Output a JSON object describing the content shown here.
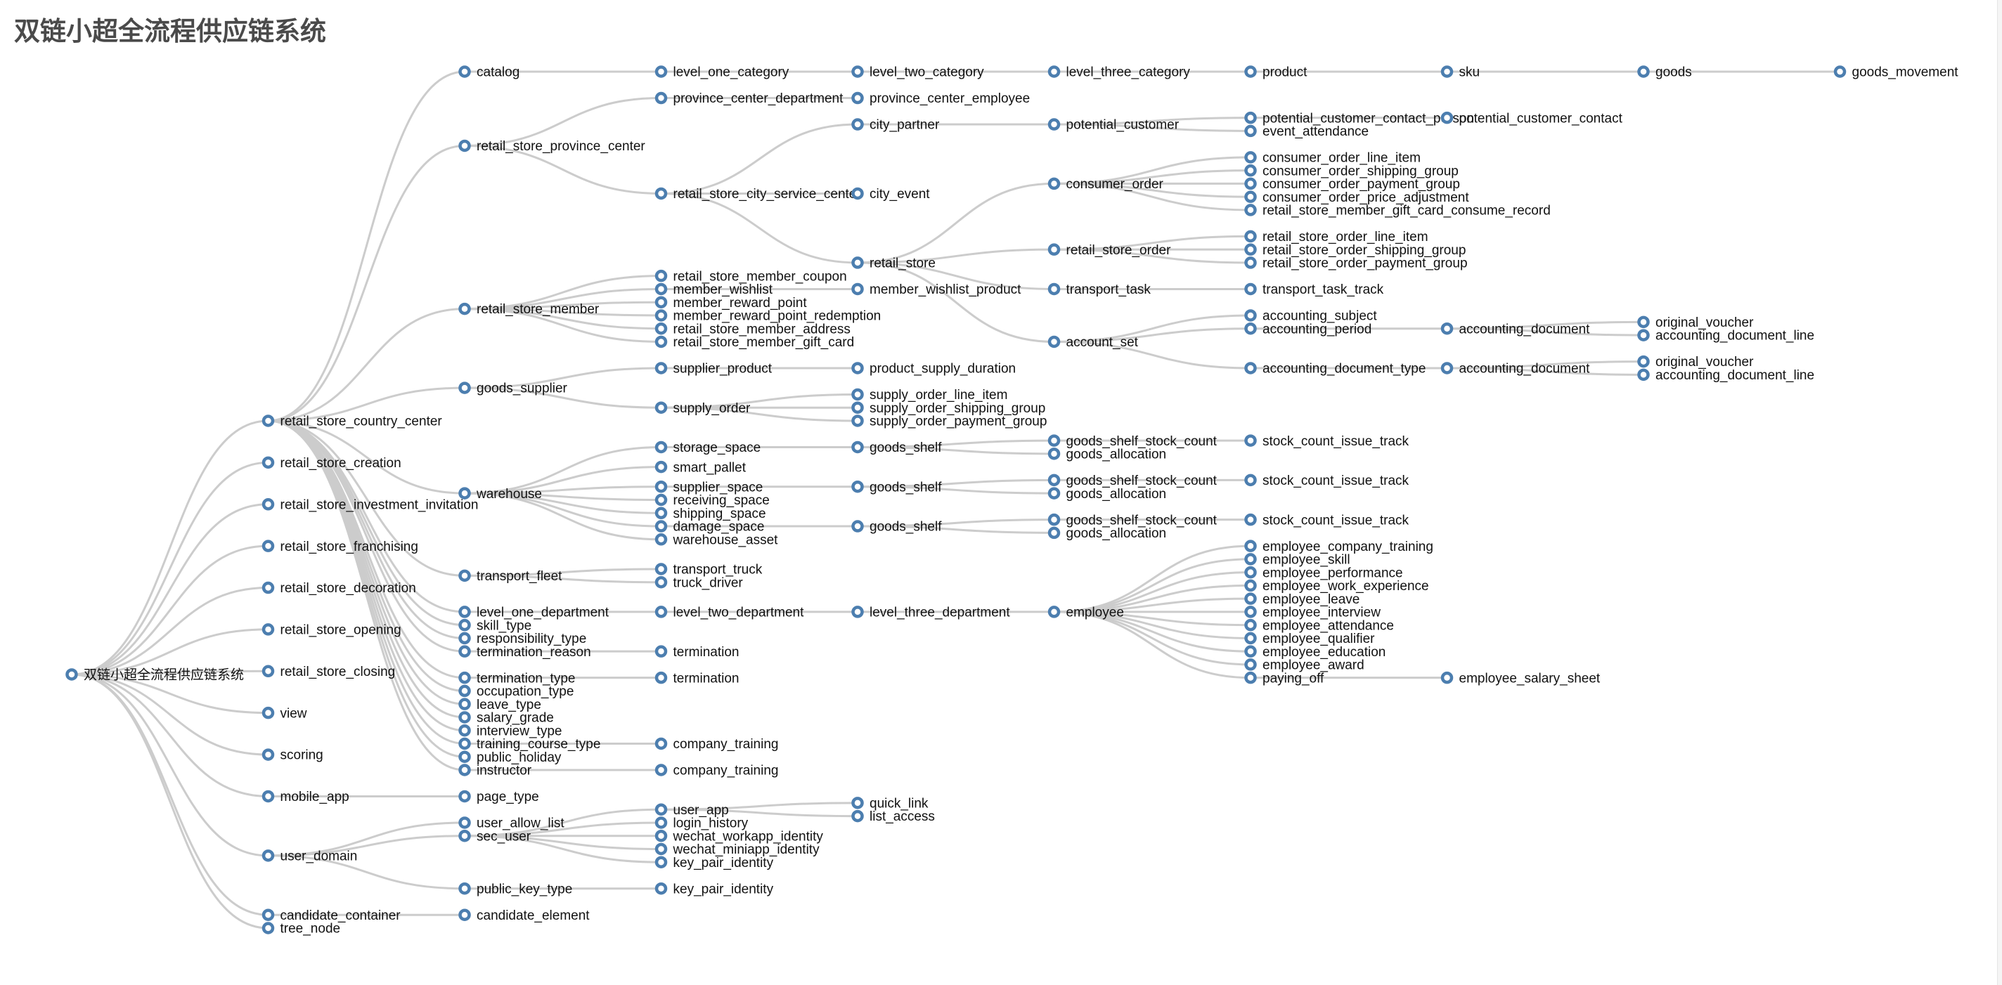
{
  "page": {
    "title": "双链小超全流程供应链系统"
  },
  "colors": {
    "node_stroke": "#4c7eaf",
    "node_fill": "#ffffff",
    "link": "#cccccc",
    "title": "#4a4a4a",
    "label": "#111111"
  },
  "tree": {
    "name": "双链小超全流程供应链系统",
    "children": [
      {
        "name": "retail_store_country_center",
        "children": [
          {
            "name": "catalog",
            "children": [
              {
                "name": "level_one_category",
                "children": [
                  {
                    "name": "level_two_category",
                    "children": [
                      {
                        "name": "level_three_category",
                        "children": [
                          {
                            "name": "product",
                            "children": [
                              {
                                "name": "sku",
                                "children": [
                                  {
                                    "name": "goods",
                                    "children": [
                                      {
                                        "name": "goods_movement"
                                      }
                                    ]
                                  }
                                ]
                              }
                            ]
                          }
                        ]
                      }
                    ]
                  }
                ]
              }
            ]
          },
          {
            "name": "retail_store_province_center",
            "children": [
              {
                "name": "province_center_department",
                "children": [
                  {
                    "name": "province_center_employee"
                  }
                ]
              },
              {
                "name": "retail_store_city_service_center",
                "children": [
                  {
                    "name": "city_partner",
                    "children": [
                      {
                        "name": "potential_customer",
                        "children": [
                          {
                            "name": "potential_customer_contact_person",
                            "children": [
                              {
                                "name": "potential_customer_contact"
                              }
                            ]
                          },
                          {
                            "name": "event_attendance"
                          }
                        ]
                      }
                    ]
                  },
                  {
                    "name": "city_event"
                  },
                  {
                    "name": "retail_store",
                    "children": [
                      {
                        "name": "consumer_order",
                        "children": [
                          {
                            "name": "consumer_order_line_item"
                          },
                          {
                            "name": "consumer_order_shipping_group"
                          },
                          {
                            "name": "consumer_order_payment_group"
                          },
                          {
                            "name": "consumer_order_price_adjustment"
                          },
                          {
                            "name": "retail_store_member_gift_card_consume_record"
                          }
                        ]
                      },
                      {
                        "name": "retail_store_order",
                        "children": [
                          {
                            "name": "retail_store_order_line_item"
                          },
                          {
                            "name": "retail_store_order_shipping_group"
                          },
                          {
                            "name": "retail_store_order_payment_group"
                          }
                        ]
                      },
                      {
                        "name": "transport_task",
                        "children": [
                          {
                            "name": "transport_task_track"
                          }
                        ]
                      },
                      {
                        "name": "account_set",
                        "children": [
                          {
                            "name": "accounting_subject"
                          },
                          {
                            "name": "accounting_period",
                            "children": [
                              {
                                "name": "accounting_document",
                                "children": [
                                  {
                                    "name": "original_voucher"
                                  },
                                  {
                                    "name": "accounting_document_line"
                                  }
                                ]
                              }
                            ]
                          },
                          {
                            "name": "accounting_document_type",
                            "children": [
                              {
                                "name": "accounting_document",
                                "children": [
                                  {
                                    "name": "original_voucher"
                                  },
                                  {
                                    "name": "accounting_document_line"
                                  }
                                ]
                              }
                            ]
                          }
                        ]
                      }
                    ]
                  }
                ]
              }
            ]
          },
          {
            "name": "retail_store_member",
            "children": [
              {
                "name": "retail_store_member_coupon"
              },
              {
                "name": "member_wishlist",
                "children": [
                  {
                    "name": "member_wishlist_product"
                  }
                ]
              },
              {
                "name": "member_reward_point"
              },
              {
                "name": "member_reward_point_redemption"
              },
              {
                "name": "retail_store_member_address"
              },
              {
                "name": "retail_store_member_gift_card"
              }
            ]
          },
          {
            "name": "goods_supplier",
            "children": [
              {
                "name": "supplier_product",
                "children": [
                  {
                    "name": "product_supply_duration"
                  }
                ]
              },
              {
                "name": "supply_order",
                "children": [
                  {
                    "name": "supply_order_line_item"
                  },
                  {
                    "name": "supply_order_shipping_group"
                  },
                  {
                    "name": "supply_order_payment_group"
                  }
                ]
              }
            ]
          },
          {
            "name": "warehouse",
            "children": [
              {
                "name": "storage_space",
                "children": [
                  {
                    "name": "goods_shelf",
                    "children": [
                      {
                        "name": "goods_shelf_stock_count",
                        "children": [
                          {
                            "name": "stock_count_issue_track"
                          }
                        ]
                      },
                      {
                        "name": "goods_allocation"
                      }
                    ]
                  }
                ]
              },
              {
                "name": "smart_pallet"
              },
              {
                "name": "supplier_space",
                "children": [
                  {
                    "name": "goods_shelf",
                    "children": [
                      {
                        "name": "goods_shelf_stock_count",
                        "children": [
                          {
                            "name": "stock_count_issue_track"
                          }
                        ]
                      },
                      {
                        "name": "goods_allocation"
                      }
                    ]
                  }
                ]
              },
              {
                "name": "receiving_space"
              },
              {
                "name": "shipping_space"
              },
              {
                "name": "damage_space",
                "children": [
                  {
                    "name": "goods_shelf",
                    "children": [
                      {
                        "name": "goods_shelf_stock_count",
                        "children": [
                          {
                            "name": "stock_count_issue_track"
                          }
                        ]
                      },
                      {
                        "name": "goods_allocation"
                      }
                    ]
                  }
                ]
              },
              {
                "name": "warehouse_asset"
              }
            ]
          },
          {
            "name": "transport_fleet",
            "children": [
              {
                "name": "transport_truck"
              },
              {
                "name": "truck_driver"
              }
            ]
          },
          {
            "name": "level_one_department",
            "children": [
              {
                "name": "level_two_department",
                "children": [
                  {
                    "name": "level_three_department",
                    "children": [
                      {
                        "name": "employee",
                        "children": [
                          {
                            "name": "employee_company_training"
                          },
                          {
                            "name": "employee_skill"
                          },
                          {
                            "name": "employee_performance"
                          },
                          {
                            "name": "employee_work_experience"
                          },
                          {
                            "name": "employee_leave"
                          },
                          {
                            "name": "employee_interview"
                          },
                          {
                            "name": "employee_attendance"
                          },
                          {
                            "name": "employee_qualifier"
                          },
                          {
                            "name": "employee_education"
                          },
                          {
                            "name": "employee_award"
                          },
                          {
                            "name": "paying_off",
                            "children": [
                              {
                                "name": "employee_salary_sheet"
                              }
                            ]
                          }
                        ]
                      }
                    ]
                  }
                ]
              }
            ]
          },
          {
            "name": "skill_type"
          },
          {
            "name": "responsibility_type"
          },
          {
            "name": "termination_reason",
            "children": [
              {
                "name": "termination"
              }
            ]
          },
          {
            "name": "termination_type",
            "children": [
              {
                "name": "termination"
              }
            ]
          },
          {
            "name": "occupation_type"
          },
          {
            "name": "leave_type"
          },
          {
            "name": "salary_grade"
          },
          {
            "name": "interview_type"
          },
          {
            "name": "training_course_type",
            "children": [
              {
                "name": "company_training"
              }
            ]
          },
          {
            "name": "public_holiday"
          },
          {
            "name": "instructor",
            "children": [
              {
                "name": "company_training"
              }
            ]
          }
        ]
      },
      {
        "name": "retail_store_creation"
      },
      {
        "name": "retail_store_investment_invitation"
      },
      {
        "name": "retail_store_franchising"
      },
      {
        "name": "retail_store_decoration"
      },
      {
        "name": "retail_store_opening"
      },
      {
        "name": "retail_store_closing"
      },
      {
        "name": "view"
      },
      {
        "name": "scoring"
      },
      {
        "name": "mobile_app",
        "children": [
          {
            "name": "page_type"
          }
        ]
      },
      {
        "name": "user_domain",
        "children": [
          {
            "name": "user_allow_list"
          },
          {
            "name": "sec_user",
            "children": [
              {
                "name": "user_app",
                "children": [
                  {
                    "name": "quick_link"
                  },
                  {
                    "name": "list_access"
                  }
                ]
              },
              {
                "name": "login_history"
              },
              {
                "name": "wechat_workapp_identity"
              },
              {
                "name": "wechat_miniapp_identity"
              },
              {
                "name": "key_pair_identity"
              }
            ]
          },
          {
            "name": "public_key_type",
            "children": [
              {
                "name": "key_pair_identity"
              }
            ]
          }
        ]
      },
      {
        "name": "candidate_container",
        "children": [
          {
            "name": "candidate_element"
          }
        ]
      },
      {
        "name": "tree_node"
      }
    ]
  }
}
